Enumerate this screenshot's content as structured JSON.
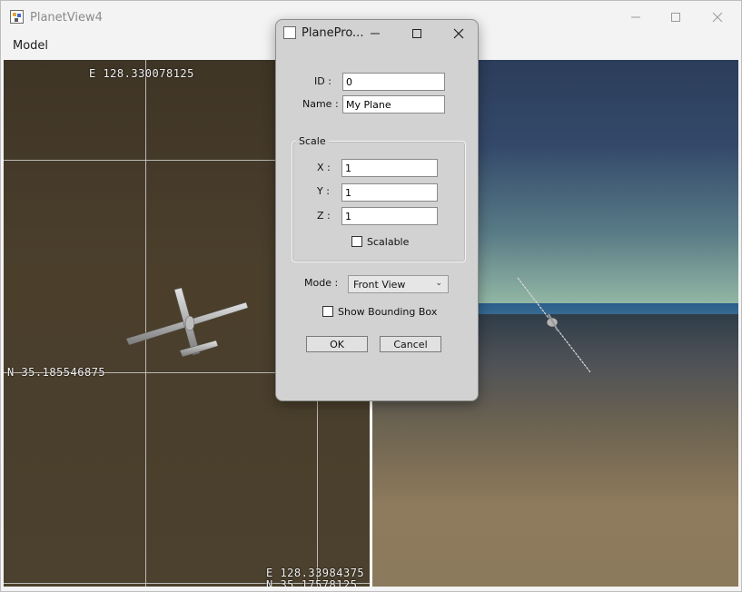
{
  "window": {
    "title": "PlanetView4"
  },
  "menu": {
    "items": [
      "Model"
    ]
  },
  "map": {
    "top_coord": "E 128.330078125",
    "left_coord": "N 35.185546875",
    "bottom_coord_e": "E 128.33984375",
    "bottom_coord_n": "N 35.17578125"
  },
  "dialog": {
    "title": "PlanePro...",
    "id_label": "ID :",
    "id_value": "0",
    "name_label": "Name :",
    "name_value": "My Plane",
    "scale_group": "Scale",
    "x_label": "X :",
    "x_value": "1",
    "y_label": "Y :",
    "y_value": "1",
    "z_label": "Z :",
    "z_value": "1",
    "scalable_label": "Scalable",
    "scalable_checked": false,
    "mode_label": "Mode :",
    "mode_value": "Front View",
    "bbox_label": "Show Bounding Box",
    "bbox_checked": false,
    "ok_label": "OK",
    "cancel_label": "Cancel"
  },
  "colors": {
    "sky_top": "#2b3d5a",
    "ground": "#4a3f2c",
    "dialog_bg": "#d2d2d2"
  }
}
